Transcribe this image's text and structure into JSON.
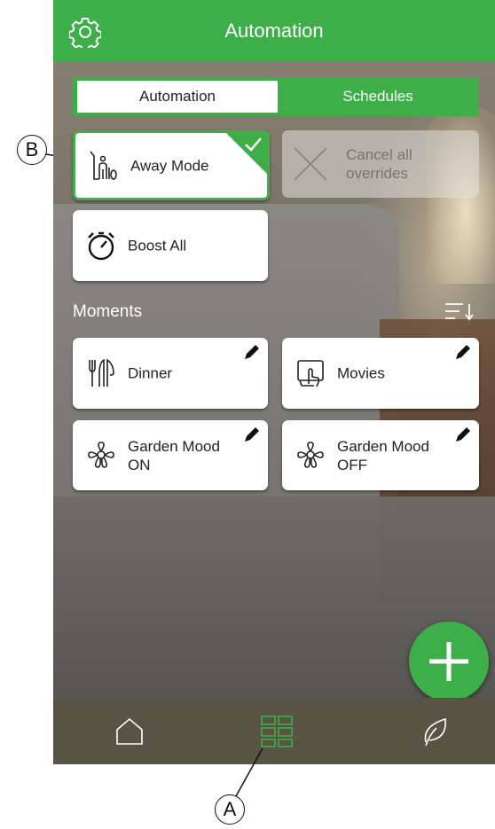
{
  "header": {
    "title": "Automation",
    "settings_icon": "gear-icon"
  },
  "tabs": [
    {
      "label": "Automation",
      "active": true
    },
    {
      "label": "Schedules",
      "active": false
    }
  ],
  "automation_cards": [
    {
      "label": "Away Mode",
      "icon": "away-person-icon",
      "selected": true
    },
    {
      "label_line1": "Cancel all",
      "label_line2": "overrides",
      "icon": "cross-icon",
      "disabled": true
    },
    {
      "label": "Boost All",
      "icon": "stopwatch-icon"
    }
  ],
  "moments": {
    "title": "Moments",
    "sort_icon": "sort-icon",
    "items": [
      {
        "label": "Dinner",
        "icon": "cutlery-icon"
      },
      {
        "label": "Movies",
        "icon": "screen-touch-icon"
      },
      {
        "label_line1": "Garden Mood",
        "label_line2": "ON",
        "icon": "flower-icon"
      },
      {
        "label_line1": "Garden Mood",
        "label_line2": "OFF",
        "icon": "flower-icon"
      }
    ]
  },
  "fab": {
    "icon": "plus-icon"
  },
  "bottom_nav": [
    {
      "icon": "home-icon"
    },
    {
      "icon": "grid-icon",
      "active": true
    },
    {
      "icon": "leaf-icon"
    }
  ],
  "callouts": {
    "a": "A",
    "b": "B"
  },
  "colors": {
    "accent": "#3dae48",
    "bottom_bar": "#585343"
  }
}
